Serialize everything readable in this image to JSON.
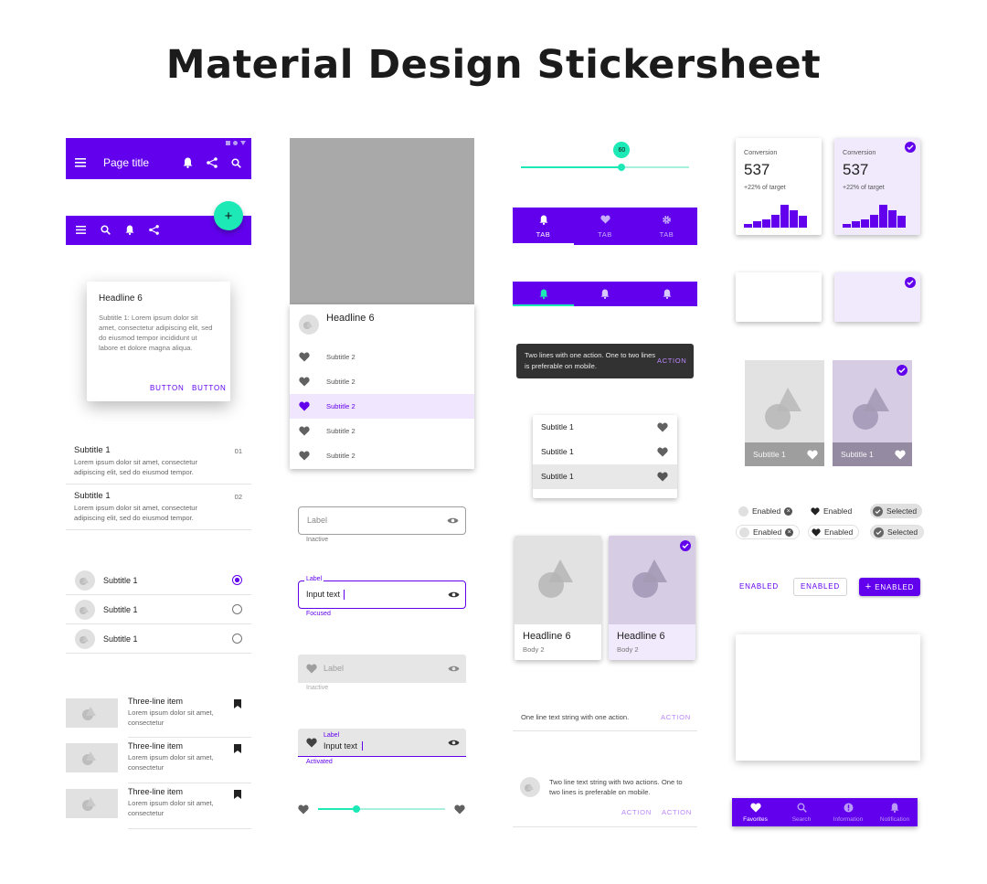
{
  "title": "Material Design Stickersheet",
  "colors": {
    "primary": "#6200ee",
    "secondary": "#1de9b6",
    "surface": "#ffffff"
  },
  "top_app_bar": {
    "title": "Page title",
    "icons": [
      "menu-icon",
      "bell-icon",
      "share-icon",
      "search-icon"
    ]
  },
  "bottom_app_bar": {
    "fab_label": "+",
    "icons": [
      "menu-icon",
      "search-icon",
      "bell-icon",
      "share-icon"
    ]
  },
  "dialog": {
    "headline": "Headline 6",
    "body": "Subtitle 1: Lorem ipsum dolor sit amet, consectetur adipiscing elit, sed do eiusmod tempor incididunt ut labore et dolore magna aliqua.",
    "button1": "BUTTON",
    "button2": "BUTTON"
  },
  "two_line_list": [
    {
      "title": "Subtitle 1",
      "body": "Lorem ipsum dolor sit amet, consectetur adipiscing elit, sed do eiusmod tempor.",
      "meta": "01"
    },
    {
      "title": "Subtitle 1",
      "body": "Lorem ipsum dolor sit amet, consectetur adipiscing elit, sed do eiusmod tempor.",
      "meta": "02"
    }
  ],
  "radio_list": [
    {
      "label": "Subtitle 1",
      "selected": true
    },
    {
      "label": "Subtitle 1",
      "selected": false
    },
    {
      "label": "Subtitle 1",
      "selected": false
    }
  ],
  "three_line_list": [
    {
      "title": "Three-line item",
      "body": "Lorem ipsum dolor sit amet, consectetur"
    },
    {
      "title": "Three-line item",
      "body": "Lorem ipsum dolor sit amet, consectetur"
    },
    {
      "title": "Three-line item",
      "body": "Lorem ipsum dolor sit amet, consectetur"
    }
  ],
  "sheet": {
    "headline": "Headline 6",
    "items": [
      "Subtitle 2",
      "Subtitle 2",
      "Subtitle 2",
      "Subtitle 2",
      "Subtitle 2"
    ],
    "selected_index": 2
  },
  "text_fields": {
    "outlined_inactive": {
      "label": "Label",
      "helper": "Inactive"
    },
    "outlined_focused": {
      "label": "Label",
      "value": "Input text",
      "helper": "Focused"
    },
    "filled_inactive": {
      "label": "Label",
      "helper": "Inactive"
    },
    "filled_activated": {
      "label": "Label",
      "value": "Input text",
      "helper": "Activated"
    }
  },
  "slider_bottom": {
    "value": 0.3
  },
  "slider_top": {
    "value_label": "60",
    "value": 0.6
  },
  "tabs": {
    "items": [
      "TAB",
      "TAB",
      "TAB"
    ],
    "icons": [
      "bell-icon",
      "heart-icon",
      "gear-icon"
    ]
  },
  "icon_tabs": {
    "icons": [
      "bell-icon",
      "bell-icon",
      "bell-icon"
    ]
  },
  "snackbar": {
    "text": "Two lines with one action. One to two lines is preferable on mobile.",
    "action": "ACTION"
  },
  "menu": {
    "items": [
      "Subtitle 1",
      "Subtitle 1",
      "Subtitle 1"
    ],
    "selected_index": 2
  },
  "cards": [
    {
      "headline": "Headline 6",
      "body": "Body 2",
      "selected": false
    },
    {
      "headline": "Headline 6",
      "body": "Body 2",
      "selected": true
    }
  ],
  "banner_one": {
    "text": "One line text string with one action.",
    "action": "ACTION"
  },
  "banner_two": {
    "text": "Two line text string with two actions. One to two lines is preferable on mobile.",
    "action1": "ACTION",
    "action2": "ACTION"
  },
  "stat_cards": [
    {
      "label": "Conversion",
      "value": "537",
      "sub": "+22% of target",
      "selected": false
    },
    {
      "label": "Conversion",
      "value": "537",
      "sub": "+22% of target",
      "selected": true
    }
  ],
  "image_list": [
    {
      "label": "Subtitle 1",
      "selected": false
    },
    {
      "label": "Subtitle 1",
      "selected": true
    }
  ],
  "chips": [
    [
      {
        "label": "Enabled",
        "kind": "input"
      },
      {
        "label": "Enabled",
        "kind": "filter"
      },
      {
        "label": "Selected",
        "kind": "selected"
      }
    ],
    [
      {
        "label": "Enabled",
        "kind": "input"
      },
      {
        "label": "Enabled",
        "kind": "filter"
      },
      {
        "label": "Selected",
        "kind": "selected"
      }
    ]
  ],
  "buttons": {
    "text": "ENABLED",
    "outlined": "ENABLED",
    "contained": "ENABLED"
  },
  "bottom_nav": {
    "items": [
      "Favorites",
      "Search",
      "Information",
      "Notification"
    ],
    "active_index": 0
  }
}
